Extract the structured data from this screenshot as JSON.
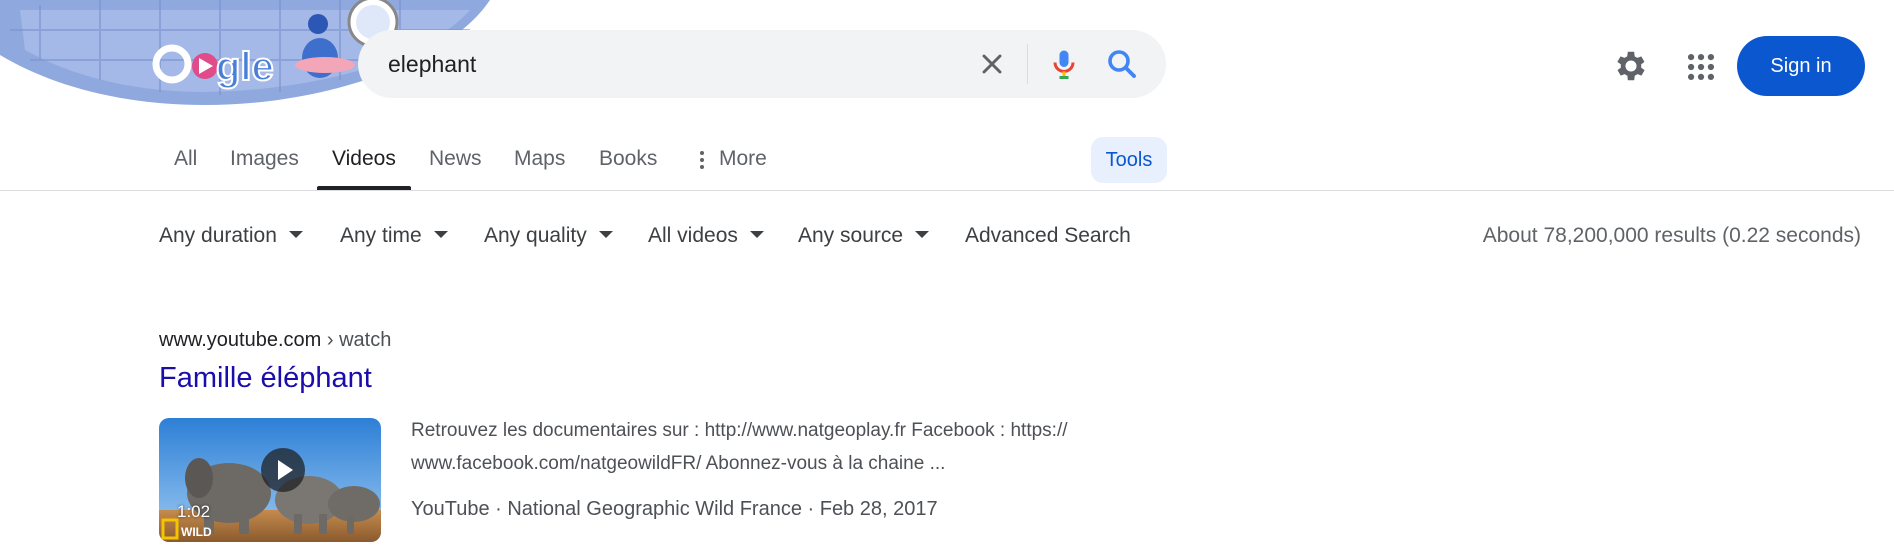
{
  "search": {
    "query": "elephant",
    "clear_icon": "close-icon",
    "mic_icon": "microphone-icon",
    "search_icon": "search-icon"
  },
  "header": {
    "settings_icon": "gear-icon",
    "apps_icon": "apps-grid-icon",
    "sign_in_label": "Sign in"
  },
  "tabs": [
    {
      "label": "All"
    },
    {
      "label": "Images"
    },
    {
      "label": "Videos",
      "active": true
    },
    {
      "label": "News"
    },
    {
      "label": "Maps"
    },
    {
      "label": "Books"
    },
    {
      "label": "More"
    }
  ],
  "tools_label": "Tools",
  "filters": {
    "duration": "Any duration",
    "time": "Any time",
    "quality": "Any quality",
    "videos": "All videos",
    "source": "Any source",
    "advanced": "Advanced Search"
  },
  "stats": "About 78,200,000 results (0.22 seconds)",
  "result": {
    "site": "www.youtube.com",
    "path": " › watch",
    "title": "Famille éléphant",
    "duration": "1:02",
    "snippet": "Retrouvez les documentaires sur : http://www.natgeoplay.fr Facebook : https:// www.facebook.com/natgeowildFR/ Abonnez-vous à la chaine ...",
    "meta": "YouTube · National Geographic Wild France · Feb 28, 2017"
  },
  "colors": {
    "accent": "#0b57d0",
    "link": "#1a0dab",
    "tools_bg": "#e8f0fe"
  }
}
